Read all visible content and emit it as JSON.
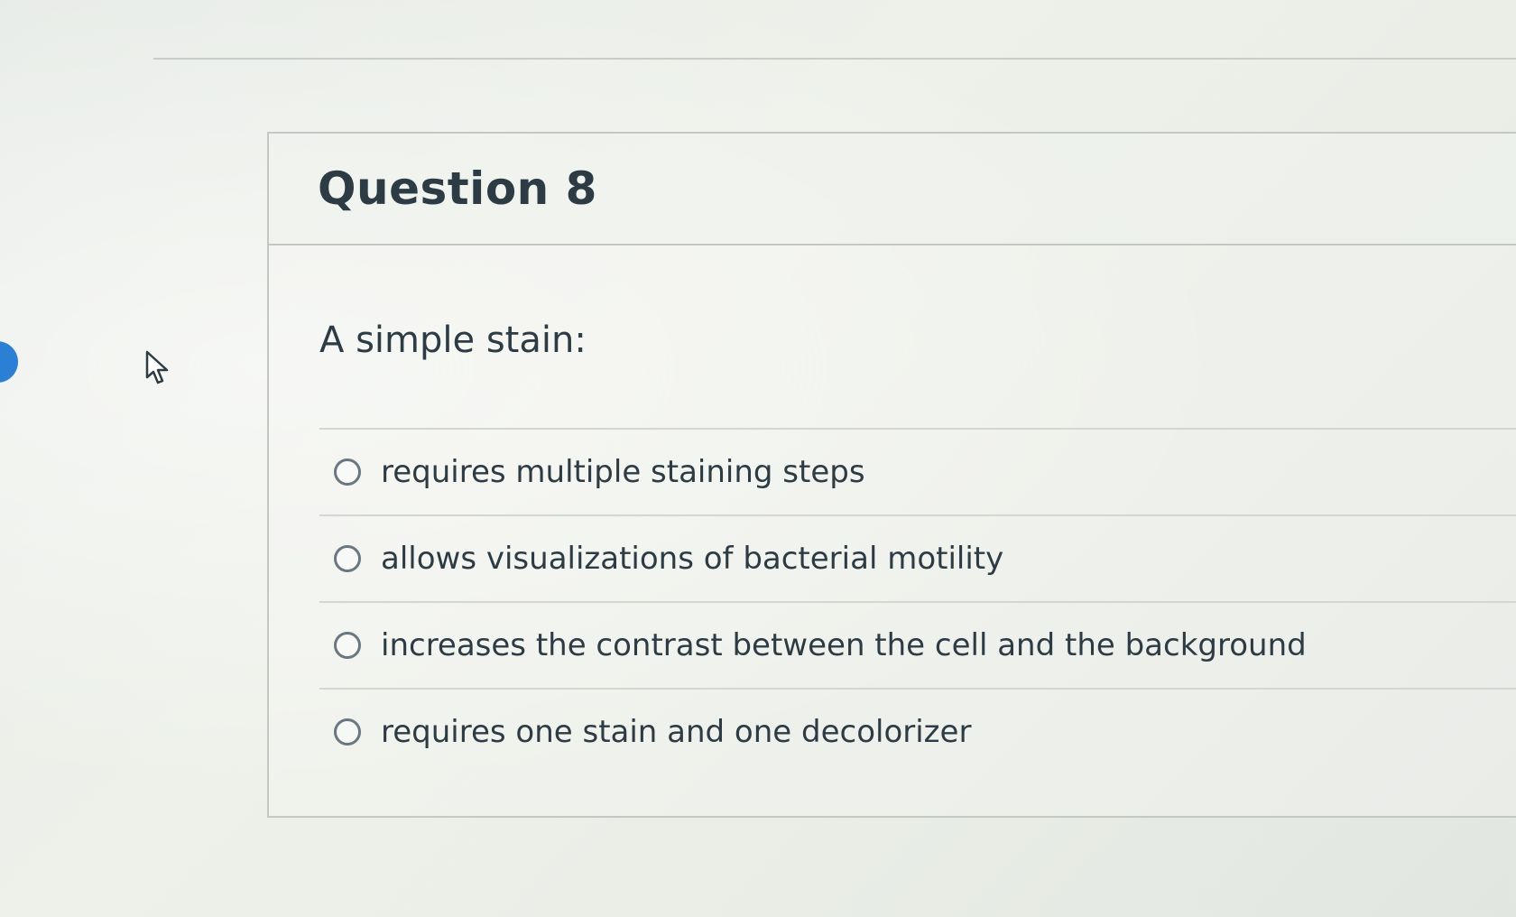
{
  "question": {
    "title": "Question 8",
    "prompt": "A simple stain:",
    "answers": [
      {
        "label": "requires multiple staining steps",
        "selected": false
      },
      {
        "label": "allows visualizations of bacterial motility",
        "selected": false
      },
      {
        "label": "increases the contrast between the cell and the background",
        "selected": false
      },
      {
        "label": "requires one stain and one decolorizer",
        "selected": false
      }
    ]
  },
  "colors": {
    "text": "#2d3b45",
    "border": "#c4c8c3",
    "accent": "#2b7fd4"
  },
  "icons": {
    "pointer": "mouse-pointer-icon",
    "radio": "radio-unchecked-icon"
  }
}
